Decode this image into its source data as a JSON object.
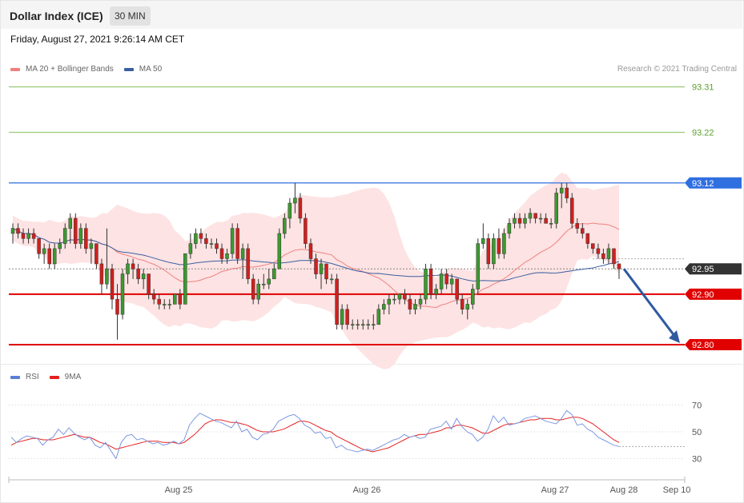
{
  "header": {
    "title": "Dollar Index (ICE)",
    "timeframe": "30 MIN"
  },
  "datetime": "Friday, August 27, 2021 9:26:14 AM CET",
  "legend_main": [
    {
      "label": "MA 20 + Bollinger Bands",
      "color": "#f08080"
    },
    {
      "label": "MA 50",
      "color": "#3a5fa0"
    }
  ],
  "legend_rsi": [
    {
      "label": "RSI",
      "color": "#5b7fd6"
    },
    {
      "label": "9MA",
      "color": "#e52020"
    }
  ],
  "credit": "Research © 2021 Trading Central",
  "chart_data": {
    "type": "candlestick",
    "x_ticks": [
      "Aug 25",
      "Aug 26",
      "Aug 27",
      "Aug 28",
      "Sep 10"
    ],
    "y_range": [
      92.77,
      93.33
    ],
    "levels": [
      {
        "value": 93.31,
        "label": "93.31",
        "kind": "resistance-green",
        "color": "#9acb7a",
        "text_color": "#5aa02c"
      },
      {
        "value": 93.22,
        "label": "93.22",
        "kind": "resistance-green",
        "color": "#9acb7a",
        "text_color": "#5aa02c"
      },
      {
        "value": 93.12,
        "label": "93.12",
        "kind": "pivot",
        "color": "#2f6fe0"
      },
      {
        "value": 92.95,
        "label": "92.95",
        "kind": "last-price",
        "color": "#333333"
      },
      {
        "value": 92.9,
        "label": "92.90",
        "kind": "support",
        "color": "#e00000"
      },
      {
        "value": 92.8,
        "label": "92.80",
        "kind": "support",
        "color": "#e00000"
      }
    ],
    "forecast_arrow": {
      "from_price": 92.95,
      "to_price": 92.8,
      "color": "#2f5aa0"
    },
    "candles": [
      {
        "o": 93.02,
        "h": 93.04,
        "l": 93.0,
        "c": 93.03
      },
      {
        "o": 93.03,
        "h": 93.04,
        "l": 93.01,
        "c": 93.02
      },
      {
        "o": 93.02,
        "h": 93.03,
        "l": 93.0,
        "c": 93.01
      },
      {
        "o": 93.01,
        "h": 93.03,
        "l": 93.0,
        "c": 93.02
      },
      {
        "o": 93.02,
        "h": 93.03,
        "l": 93.0,
        "c": 93.01
      },
      {
        "o": 93.01,
        "h": 93.01,
        "l": 92.97,
        "c": 92.98
      },
      {
        "o": 92.98,
        "h": 93.0,
        "l": 92.96,
        "c": 92.99
      },
      {
        "o": 92.99,
        "h": 93.0,
        "l": 92.95,
        "c": 92.96
      },
      {
        "o": 92.96,
        "h": 93.0,
        "l": 92.95,
        "c": 92.99
      },
      {
        "o": 92.99,
        "h": 93.01,
        "l": 92.98,
        "c": 93.0
      },
      {
        "o": 93.0,
        "h": 93.04,
        "l": 92.99,
        "c": 93.03
      },
      {
        "o": 93.03,
        "h": 93.06,
        "l": 93.0,
        "c": 93.05
      },
      {
        "o": 93.05,
        "h": 93.06,
        "l": 92.99,
        "c": 93.0
      },
      {
        "o": 93.0,
        "h": 93.04,
        "l": 92.99,
        "c": 93.03
      },
      {
        "o": 93.03,
        "h": 93.04,
        "l": 92.98,
        "c": 92.99
      },
      {
        "o": 92.99,
        "h": 93.01,
        "l": 92.96,
        "c": 93.0
      },
      {
        "o": 93.0,
        "h": 93.0,
        "l": 92.95,
        "c": 92.96
      },
      {
        "o": 92.96,
        "h": 92.97,
        "l": 92.9,
        "c": 92.92
      },
      {
        "o": 92.92,
        "h": 93.03,
        "l": 92.91,
        "c": 92.95
      },
      {
        "o": 92.95,
        "h": 92.96,
        "l": 92.87,
        "c": 92.89
      },
      {
        "o": 92.89,
        "h": 92.92,
        "l": 92.81,
        "c": 92.86
      },
      {
        "o": 92.86,
        "h": 92.95,
        "l": 92.85,
        "c": 92.94
      },
      {
        "o": 92.94,
        "h": 92.97,
        "l": 92.92,
        "c": 92.96
      },
      {
        "o": 92.96,
        "h": 92.97,
        "l": 92.93,
        "c": 92.95
      },
      {
        "o": 92.95,
        "h": 92.96,
        "l": 92.92,
        "c": 92.93
      },
      {
        "o": 92.93,
        "h": 92.95,
        "l": 92.91,
        "c": 92.94
      },
      {
        "o": 92.94,
        "h": 92.94,
        "l": 92.89,
        "c": 92.9
      },
      {
        "o": 92.9,
        "h": 92.91,
        "l": 92.88,
        "c": 92.89
      },
      {
        "o": 92.89,
        "h": 92.9,
        "l": 92.87,
        "c": 92.88
      },
      {
        "o": 92.88,
        "h": 92.89,
        "l": 92.87,
        "c": 92.88
      },
      {
        "o": 92.88,
        "h": 92.89,
        "l": 92.87,
        "c": 92.88
      },
      {
        "o": 92.88,
        "h": 92.9,
        "l": 92.88,
        "c": 92.9
      },
      {
        "o": 92.9,
        "h": 92.91,
        "l": 92.87,
        "c": 92.88
      },
      {
        "o": 92.88,
        "h": 92.98,
        "l": 92.88,
        "c": 92.98
      },
      {
        "o": 92.98,
        "h": 93.02,
        "l": 92.97,
        "c": 93.0
      },
      {
        "o": 93.0,
        "h": 93.03,
        "l": 92.99,
        "c": 93.02
      },
      {
        "o": 93.02,
        "h": 93.03,
        "l": 93.0,
        "c": 93.01
      },
      {
        "o": 93.01,
        "h": 93.02,
        "l": 92.99,
        "c": 93.0
      },
      {
        "o": 93.0,
        "h": 93.01,
        "l": 92.99,
        "c": 93.0
      },
      {
        "o": 93.0,
        "h": 93.01,
        "l": 92.98,
        "c": 92.99
      },
      {
        "o": 92.99,
        "h": 93.0,
        "l": 92.96,
        "c": 92.97
      },
      {
        "o": 92.97,
        "h": 92.99,
        "l": 92.96,
        "c": 92.98
      },
      {
        "o": 92.98,
        "h": 93.04,
        "l": 92.97,
        "c": 93.03
      },
      {
        "o": 93.03,
        "h": 93.04,
        "l": 92.96,
        "c": 92.97
      },
      {
        "o": 92.97,
        "h": 93.0,
        "l": 92.93,
        "c": 92.99
      },
      {
        "o": 92.99,
        "h": 93.0,
        "l": 92.92,
        "c": 92.93
      },
      {
        "o": 92.93,
        "h": 92.94,
        "l": 92.88,
        "c": 92.89
      },
      {
        "o": 92.89,
        "h": 92.93,
        "l": 92.88,
        "c": 92.92
      },
      {
        "o": 92.92,
        "h": 92.94,
        "l": 92.91,
        "c": 92.92
      },
      {
        "o": 92.92,
        "h": 92.95,
        "l": 92.91,
        "c": 92.93
      },
      {
        "o": 92.93,
        "h": 92.96,
        "l": 92.93,
        "c": 92.95
      },
      {
        "o": 92.95,
        "h": 93.03,
        "l": 92.95,
        "c": 93.02
      },
      {
        "o": 93.02,
        "h": 93.06,
        "l": 93.01,
        "c": 93.05
      },
      {
        "o": 93.05,
        "h": 93.09,
        "l": 93.03,
        "c": 93.08
      },
      {
        "o": 93.08,
        "h": 93.12,
        "l": 93.06,
        "c": 93.09
      },
      {
        "o": 93.09,
        "h": 93.1,
        "l": 93.04,
        "c": 93.05
      },
      {
        "o": 93.05,
        "h": 93.06,
        "l": 92.99,
        "c": 93.0
      },
      {
        "o": 93.0,
        "h": 93.01,
        "l": 92.96,
        "c": 92.97
      },
      {
        "o": 92.97,
        "h": 92.98,
        "l": 92.93,
        "c": 92.94
      },
      {
        "o": 92.94,
        "h": 92.97,
        "l": 92.91,
        "c": 92.96
      },
      {
        "o": 92.96,
        "h": 92.96,
        "l": 92.92,
        "c": 92.93
      },
      {
        "o": 92.93,
        "h": 92.94,
        "l": 92.92,
        "c": 92.93
      },
      {
        "o": 92.93,
        "h": 92.94,
        "l": 92.83,
        "c": 92.84
      },
      {
        "o": 92.84,
        "h": 92.88,
        "l": 92.83,
        "c": 92.87
      },
      {
        "o": 92.87,
        "h": 92.88,
        "l": 92.83,
        "c": 92.84
      },
      {
        "o": 92.84,
        "h": 92.85,
        "l": 92.83,
        "c": 92.84
      },
      {
        "o": 92.84,
        "h": 92.85,
        "l": 92.83,
        "c": 92.84
      },
      {
        "o": 92.84,
        "h": 92.85,
        "l": 92.83,
        "c": 92.84
      },
      {
        "o": 92.84,
        "h": 92.85,
        "l": 92.83,
        "c": 92.84
      },
      {
        "o": 92.84,
        "h": 92.86,
        "l": 92.83,
        "c": 92.84
      },
      {
        "o": 92.84,
        "h": 92.88,
        "l": 92.84,
        "c": 92.87
      },
      {
        "o": 92.87,
        "h": 92.89,
        "l": 92.86,
        "c": 92.88
      },
      {
        "o": 92.88,
        "h": 92.9,
        "l": 92.86,
        "c": 92.89
      },
      {
        "o": 92.89,
        "h": 92.9,
        "l": 92.88,
        "c": 92.89
      },
      {
        "o": 92.89,
        "h": 92.9,
        "l": 92.88,
        "c": 92.9
      },
      {
        "o": 92.9,
        "h": 92.91,
        "l": 92.88,
        "c": 92.89
      },
      {
        "o": 92.89,
        "h": 92.9,
        "l": 92.86,
        "c": 92.87
      },
      {
        "o": 92.87,
        "h": 92.89,
        "l": 92.86,
        "c": 92.88
      },
      {
        "o": 92.88,
        "h": 92.9,
        "l": 92.87,
        "c": 92.89
      },
      {
        "o": 92.89,
        "h": 92.96,
        "l": 92.88,
        "c": 92.95
      },
      {
        "o": 92.95,
        "h": 92.96,
        "l": 92.89,
        "c": 92.9
      },
      {
        "o": 92.9,
        "h": 92.92,
        "l": 92.89,
        "c": 92.91
      },
      {
        "o": 92.91,
        "h": 92.95,
        "l": 92.9,
        "c": 92.94
      },
      {
        "o": 92.94,
        "h": 92.95,
        "l": 92.91,
        "c": 92.92
      },
      {
        "o": 92.92,
        "h": 92.94,
        "l": 92.9,
        "c": 92.93
      },
      {
        "o": 92.93,
        "h": 92.93,
        "l": 92.88,
        "c": 92.89
      },
      {
        "o": 92.89,
        "h": 92.9,
        "l": 92.86,
        "c": 92.87
      },
      {
        "o": 92.87,
        "h": 92.89,
        "l": 92.85,
        "c": 92.88
      },
      {
        "o": 92.88,
        "h": 92.92,
        "l": 92.87,
        "c": 92.91
      },
      {
        "o": 92.91,
        "h": 93.01,
        "l": 92.9,
        "c": 93.0
      },
      {
        "o": 93.0,
        "h": 93.04,
        "l": 92.99,
        "c": 93.01
      },
      {
        "o": 93.01,
        "h": 93.02,
        "l": 92.95,
        "c": 92.96
      },
      {
        "o": 92.96,
        "h": 93.02,
        "l": 92.95,
        "c": 93.01
      },
      {
        "o": 93.01,
        "h": 93.03,
        "l": 92.97,
        "c": 92.98
      },
      {
        "o": 92.98,
        "h": 93.03,
        "l": 92.97,
        "c": 93.02
      },
      {
        "o": 93.02,
        "h": 93.05,
        "l": 93.01,
        "c": 93.04
      },
      {
        "o": 93.04,
        "h": 93.06,
        "l": 93.03,
        "c": 93.05
      },
      {
        "o": 93.05,
        "h": 93.06,
        "l": 93.03,
        "c": 93.04
      },
      {
        "o": 93.04,
        "h": 93.06,
        "l": 93.03,
        "c": 93.05
      },
      {
        "o": 93.05,
        "h": 93.07,
        "l": 93.04,
        "c": 93.06
      },
      {
        "o": 93.06,
        "h": 93.06,
        "l": 93.04,
        "c": 93.05
      },
      {
        "o": 93.05,
        "h": 93.06,
        "l": 93.04,
        "c": 93.05
      },
      {
        "o": 93.05,
        "h": 93.06,
        "l": 93.04,
        "c": 93.04
      },
      {
        "o": 93.04,
        "h": 93.05,
        "l": 93.03,
        "c": 93.04
      },
      {
        "o": 93.04,
        "h": 93.11,
        "l": 93.03,
        "c": 93.1
      },
      {
        "o": 93.1,
        "h": 93.12,
        "l": 93.07,
        "c": 93.11
      },
      {
        "o": 93.11,
        "h": 93.12,
        "l": 93.08,
        "c": 93.09
      },
      {
        "o": 93.09,
        "h": 93.1,
        "l": 93.03,
        "c": 93.04
      },
      {
        "o": 93.04,
        "h": 93.05,
        "l": 93.02,
        "c": 93.03
      },
      {
        "o": 93.03,
        "h": 93.04,
        "l": 93.01,
        "c": 93.02
      },
      {
        "o": 93.02,
        "h": 93.02,
        "l": 92.99,
        "c": 93.0
      },
      {
        "o": 93.0,
        "h": 93.0,
        "l": 92.98,
        "c": 92.99
      },
      {
        "o": 92.99,
        "h": 93.0,
        "l": 92.97,
        "c": 92.98
      },
      {
        "o": 92.98,
        "h": 92.99,
        "l": 92.96,
        "c": 92.97
      },
      {
        "o": 92.97,
        "h": 93.0,
        "l": 92.96,
        "c": 92.99
      },
      {
        "o": 92.99,
        "h": 92.99,
        "l": 92.95,
        "c": 92.96
      },
      {
        "o": 92.96,
        "h": 92.96,
        "l": 92.93,
        "c": 92.95
      }
    ],
    "rsi": {
      "ticks": [
        "70",
        "50",
        "30"
      ],
      "y_range": [
        20,
        80
      ],
      "rsi_values": [
        46,
        42,
        45,
        47,
        46,
        45,
        40,
        44,
        46,
        52,
        48,
        53,
        49,
        46,
        44,
        46,
        40,
        38,
        42,
        36,
        30,
        42,
        47,
        48,
        44,
        45,
        43,
        41,
        42,
        40,
        41,
        43,
        41,
        44,
        55,
        60,
        64,
        62,
        60,
        58,
        57,
        55,
        53,
        58,
        50,
        52,
        46,
        44,
        48,
        49,
        52,
        58,
        60,
        62,
        63,
        60,
        55,
        53,
        49,
        50,
        45,
        46,
        38,
        40,
        37,
        36,
        35,
        36,
        37,
        36,
        38,
        40,
        42,
        44,
        45,
        48,
        46,
        47,
        45,
        46,
        52,
        53,
        54,
        58,
        52,
        60,
        54,
        50,
        48,
        43,
        46,
        52,
        62,
        57,
        61,
        55,
        56,
        57,
        60,
        61,
        62,
        60,
        58,
        57,
        56,
        60,
        66,
        63,
        55,
        56,
        52,
        50,
        46,
        44,
        42,
        40,
        39
      ],
      "ma_values": [
        40,
        42,
        43,
        44,
        45,
        45,
        44,
        44,
        44,
        45,
        46,
        47,
        48,
        47,
        46,
        46,
        44,
        42,
        41,
        39,
        37,
        38,
        39,
        40,
        41,
        42,
        43,
        43,
        43,
        42,
        42,
        42,
        41,
        42,
        45,
        48,
        52,
        56,
        58,
        59,
        59,
        58,
        57,
        57,
        56,
        55,
        53,
        51,
        50,
        50,
        50,
        51,
        52,
        54,
        56,
        58,
        58,
        57,
        55,
        53,
        51,
        50,
        47,
        45,
        43,
        41,
        39,
        37,
        36,
        35,
        36,
        37,
        38,
        40,
        42,
        44,
        46,
        47,
        48,
        48,
        49,
        50,
        51,
        53,
        53,
        55,
        55,
        54,
        53,
        51,
        49,
        49,
        51,
        53,
        55,
        56,
        56,
        57,
        58,
        59,
        59,
        60,
        60,
        60,
        59,
        59,
        60,
        61,
        61,
        60,
        58,
        56,
        53,
        50,
        47,
        44,
        42
      ]
    }
  }
}
